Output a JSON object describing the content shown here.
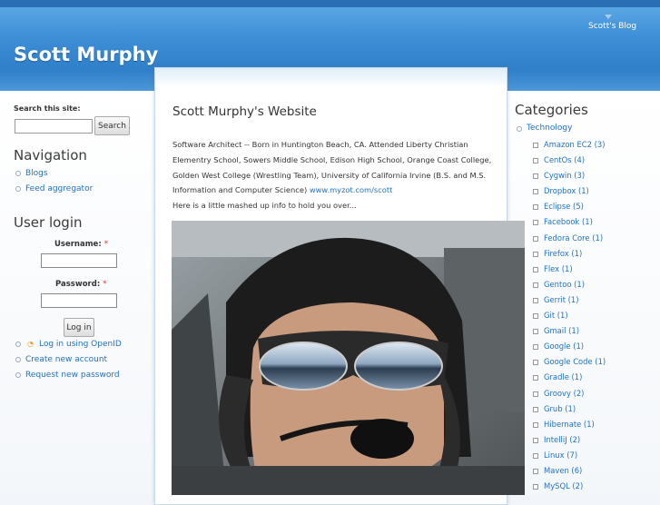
{
  "header": {
    "site_name": "Scott Murphy",
    "primary_links": [
      "Scott's Blog"
    ]
  },
  "search": {
    "label": "Search this site:",
    "input_value": "",
    "button": "Search"
  },
  "navigation": {
    "title": "Navigation",
    "items": [
      "Blogs",
      "Feed aggregator"
    ]
  },
  "login": {
    "title": "User login",
    "username_label": "Username:",
    "password_label": "Password:",
    "required_mark": "*",
    "button": "Log in",
    "links": [
      "Log in using OpenID",
      "Create new account",
      "Request new password"
    ]
  },
  "node": {
    "title": "Scott Murphy's Website",
    "body": "Software Architect -- Born in Huntington Beach, CA. Attended Liberty Christian Elementry School, Sowers Middle School, Edison High School, Orange Coast College, Golden West College (Wrestling Team), University of California Irvine (B.S. and M.S. Information and Computer Science)",
    "link": "www.myzot.com/scott",
    "intro": "Here is a little mashed up info to hold you over..."
  },
  "categories": {
    "title": "Categories",
    "root": "Technology",
    "items": [
      "Amazon EC2 (3)",
      "CentOs (4)",
      "Cygwin (3)",
      "Dropbox (1)",
      "Eclipse (5)",
      "Facebook (1)",
      "Fedora Core (1)",
      "Firefox (1)",
      "Flex (1)",
      "Gentoo (1)",
      "Gerrit (1)",
      "Git (1)",
      "Gmail (1)",
      "Google (1)",
      "Google Code (1)",
      "Gradle (1)",
      "Groovy (2)",
      "Grub (1)",
      "Hibernate (1)",
      "IntelliJ (2)",
      "Linux (7)",
      "Maven (6)",
      "MySQL (2)"
    ]
  },
  "colors": {
    "header_blue": "#3e8fd6",
    "link_blue": "#2273c0"
  }
}
